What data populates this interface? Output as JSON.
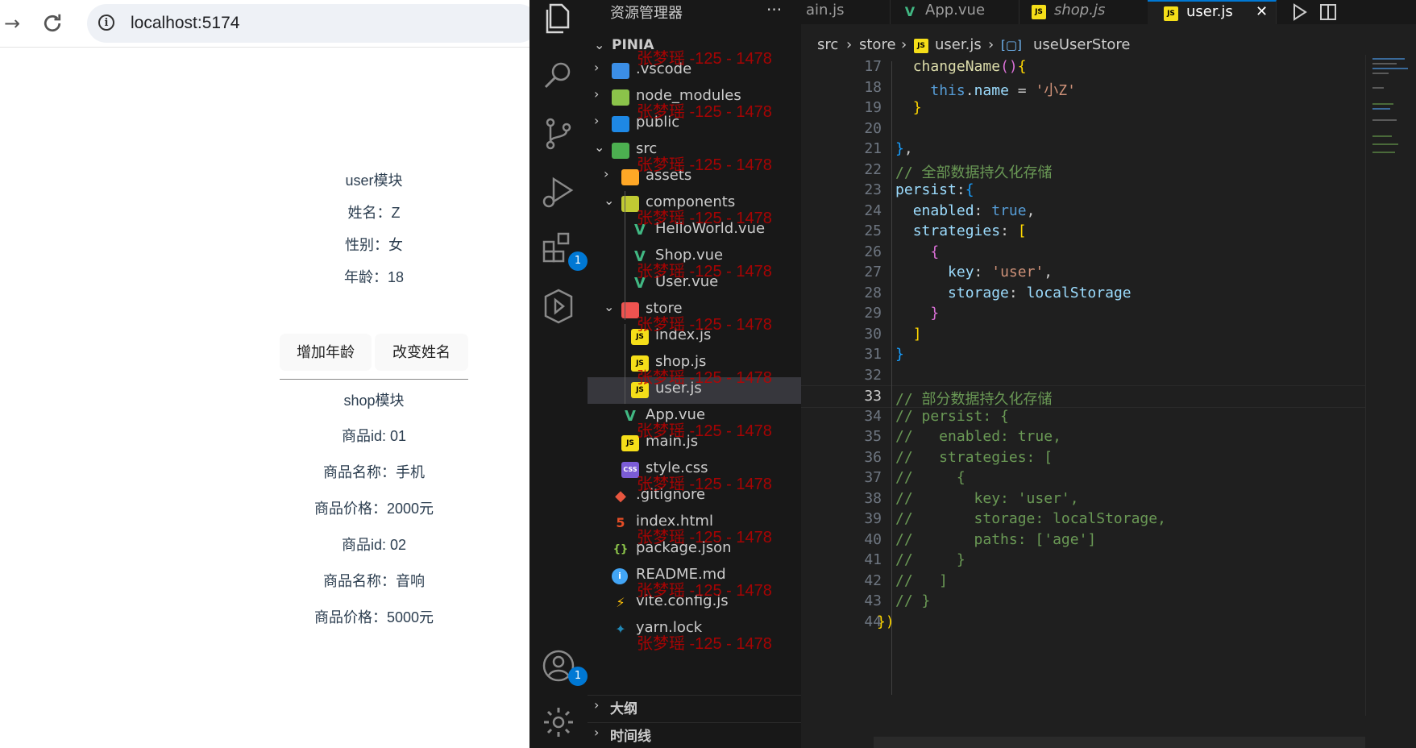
{
  "browser": {
    "url": "localhost:5174",
    "user_module": {
      "title": "user模块",
      "name": "姓名：Z",
      "gender": "性别：女",
      "age": "年龄：18",
      "add_age_button": "增加年龄",
      "change_name_button": "改变姓名"
    },
    "shop_module": {
      "title": "shop模块",
      "items": [
        {
          "id": "商品id: 01",
          "name": "商品名称：手机",
          "price": "商品价格：2000元"
        },
        {
          "id": "商品id: 02",
          "name": "商品名称：音响",
          "price": "商品价格：5000元"
        }
      ]
    }
  },
  "vscode": {
    "explorer_title": "资源管理器",
    "more": "···",
    "root_folder": "PINIA",
    "tree": [
      {
        "label": ".vscode",
        "chevron": "›",
        "icon": "vscode",
        "color": "#3b8ee6"
      },
      {
        "label": "node_modules",
        "chevron": "›",
        "icon": "node",
        "color": "#8bc34a"
      },
      {
        "label": "public",
        "chevron": "›",
        "icon": "public",
        "color": "#1e88e5"
      },
      {
        "label": "src",
        "chevron": "⌄",
        "icon": "src",
        "color": "#4caf50"
      },
      {
        "label": "assets",
        "chevron": "›",
        "icon": "assets",
        "color": "#ffa726"
      },
      {
        "label": "components",
        "chevron": "⌄",
        "icon": "components",
        "color": "#c0ca33"
      },
      {
        "label": "HelloWorld.vue",
        "chevron": "",
        "icon": "V",
        "color": "#41b883"
      },
      {
        "label": "Shop.vue",
        "chevron": "",
        "icon": "V",
        "color": "#41b883"
      },
      {
        "label": "User.vue",
        "chevron": "",
        "icon": "V",
        "color": "#41b883"
      },
      {
        "label": "store",
        "chevron": "⌄",
        "icon": "store",
        "color": "#ef5350"
      },
      {
        "label": "index.js",
        "chevron": "",
        "icon": "JS",
        "color": "#f5de19"
      },
      {
        "label": "shop.js",
        "chevron": "",
        "icon": "JS",
        "color": "#f5de19"
      },
      {
        "label": "user.js",
        "chevron": "",
        "icon": "JS",
        "color": "#f5de19"
      },
      {
        "label": "App.vue",
        "chevron": "",
        "icon": "V",
        "color": "#41b883"
      },
      {
        "label": "main.js",
        "chevron": "",
        "icon": "JS",
        "color": "#f5de19"
      },
      {
        "label": "style.css",
        "chevron": "",
        "icon": "CSS",
        "color": "#7b5cd6"
      },
      {
        "label": ".gitignore",
        "chevron": "",
        "icon": "git",
        "color": "#e8563f"
      },
      {
        "label": "index.html",
        "chevron": "",
        "icon": "5",
        "color": "#e44d26"
      },
      {
        "label": "package.json",
        "chevron": "",
        "icon": "{}",
        "color": "#8bc34a"
      },
      {
        "label": "README.md",
        "chevron": "",
        "icon": "i",
        "color": "#42a5f5"
      },
      {
        "label": "vite.config.js",
        "chevron": "",
        "icon": "⚡",
        "color": "#ffc107"
      },
      {
        "label": "yarn.lock",
        "chevron": "",
        "icon": "yarn",
        "color": "#2188b6"
      }
    ],
    "panels": {
      "outline": "大纲",
      "timeline": "时间线"
    },
    "activity_badges": {
      "extensions": "1",
      "accounts": "1"
    },
    "tabs": [
      {
        "label": "ain.js",
        "icon": "",
        "active": false,
        "italic": false
      },
      {
        "label": "App.vue",
        "icon": "V",
        "active": false,
        "italic": false
      },
      {
        "label": "shop.js",
        "icon": "JS",
        "active": false,
        "italic": true
      },
      {
        "label": "user.js",
        "icon": "JS",
        "active": true,
        "italic": false
      }
    ],
    "tab_close": "✕",
    "breadcrumb": {
      "p1": "src",
      "p2": "store",
      "p3": "user.js",
      "p4": "useUserStore",
      "sep": "›"
    },
    "code": [
      {
        "n": "17",
        "t": [
          [
            "  ",
            ""
          ],
          [
            "changeName",
            "f"
          ],
          [
            "()",
            "p"
          ],
          [
            "{",
            "y"
          ]
        ]
      },
      {
        "n": "18",
        "t": [
          [
            "    ",
            ""
          ],
          [
            "this",
            "b"
          ],
          [
            ".",
            ""
          ],
          [
            "name",
            "k"
          ],
          [
            " = ",
            ""
          ],
          [
            "'小Z'",
            "s"
          ]
        ]
      },
      {
        "n": "19",
        "t": [
          [
            "  ",
            ""
          ],
          [
            "}",
            "y"
          ]
        ]
      },
      {
        "n": "20",
        "t": []
      },
      {
        "n": "21",
        "t": [
          [
            "}",
            "bl"
          ],
          [
            ",",
            ""
          ]
        ]
      },
      {
        "n": "22",
        "t": [
          [
            "// 全部数据持久化存储",
            "c"
          ]
        ]
      },
      {
        "n": "23",
        "t": [
          [
            "persist",
            "k"
          ],
          [
            ":",
            ""
          ],
          [
            "{",
            "bl"
          ]
        ]
      },
      {
        "n": "24",
        "t": [
          [
            "  ",
            ""
          ],
          [
            "enabled",
            "k"
          ],
          [
            ": ",
            ""
          ],
          [
            "true",
            "b"
          ],
          [
            ",",
            ""
          ]
        ]
      },
      {
        "n": "25",
        "t": [
          [
            "  ",
            ""
          ],
          [
            "strategies",
            "k"
          ],
          [
            ": ",
            ""
          ],
          [
            "[",
            "y"
          ]
        ]
      },
      {
        "n": "26",
        "t": [
          [
            "    ",
            ""
          ],
          [
            "{",
            "p"
          ]
        ]
      },
      {
        "n": "27",
        "t": [
          [
            "      ",
            ""
          ],
          [
            "key",
            "k"
          ],
          [
            ": ",
            ""
          ],
          [
            "'user'",
            "s"
          ],
          [
            ",",
            ""
          ]
        ]
      },
      {
        "n": "28",
        "t": [
          [
            "      ",
            ""
          ],
          [
            "storage",
            "k"
          ],
          [
            ": ",
            ""
          ],
          [
            "localStorage",
            "k"
          ]
        ]
      },
      {
        "n": "29",
        "t": [
          [
            "    ",
            ""
          ],
          [
            "}",
            "p"
          ]
        ]
      },
      {
        "n": "30",
        "t": [
          [
            "  ",
            ""
          ],
          [
            "]",
            "y"
          ]
        ]
      },
      {
        "n": "31",
        "t": [
          [
            "}",
            "bl"
          ]
        ]
      },
      {
        "n": "32",
        "t": []
      },
      {
        "n": "33",
        "t": [
          [
            "// 部分数据持久化存储",
            "c"
          ]
        ],
        "current": true
      },
      {
        "n": "34",
        "t": [
          [
            "// persist: {",
            "c"
          ]
        ]
      },
      {
        "n": "35",
        "t": [
          [
            "//   enabled: true,",
            "c"
          ]
        ]
      },
      {
        "n": "36",
        "t": [
          [
            "//   strategies: [",
            "c"
          ]
        ]
      },
      {
        "n": "37",
        "t": [
          [
            "//     {",
            "c"
          ]
        ]
      },
      {
        "n": "38",
        "t": [
          [
            "//       key: 'user',",
            "c"
          ]
        ]
      },
      {
        "n": "39",
        "t": [
          [
            "//       storage: localStorage,",
            "c"
          ]
        ]
      },
      {
        "n": "40",
        "t": [
          [
            "//       paths: ['age']",
            "c"
          ]
        ]
      },
      {
        "n": "41",
        "t": [
          [
            "//     }",
            "c"
          ]
        ]
      },
      {
        "n": "42",
        "t": [
          [
            "//   ]",
            "c"
          ]
        ]
      },
      {
        "n": "43",
        "t": [
          [
            "// }",
            "c"
          ]
        ]
      },
      {
        "n": "44",
        "t": [
          [
            "})",
            "y"
          ]
        ],
        "outdent": true
      }
    ]
  },
  "watermark": "张梦瑶 -125 - 1478"
}
